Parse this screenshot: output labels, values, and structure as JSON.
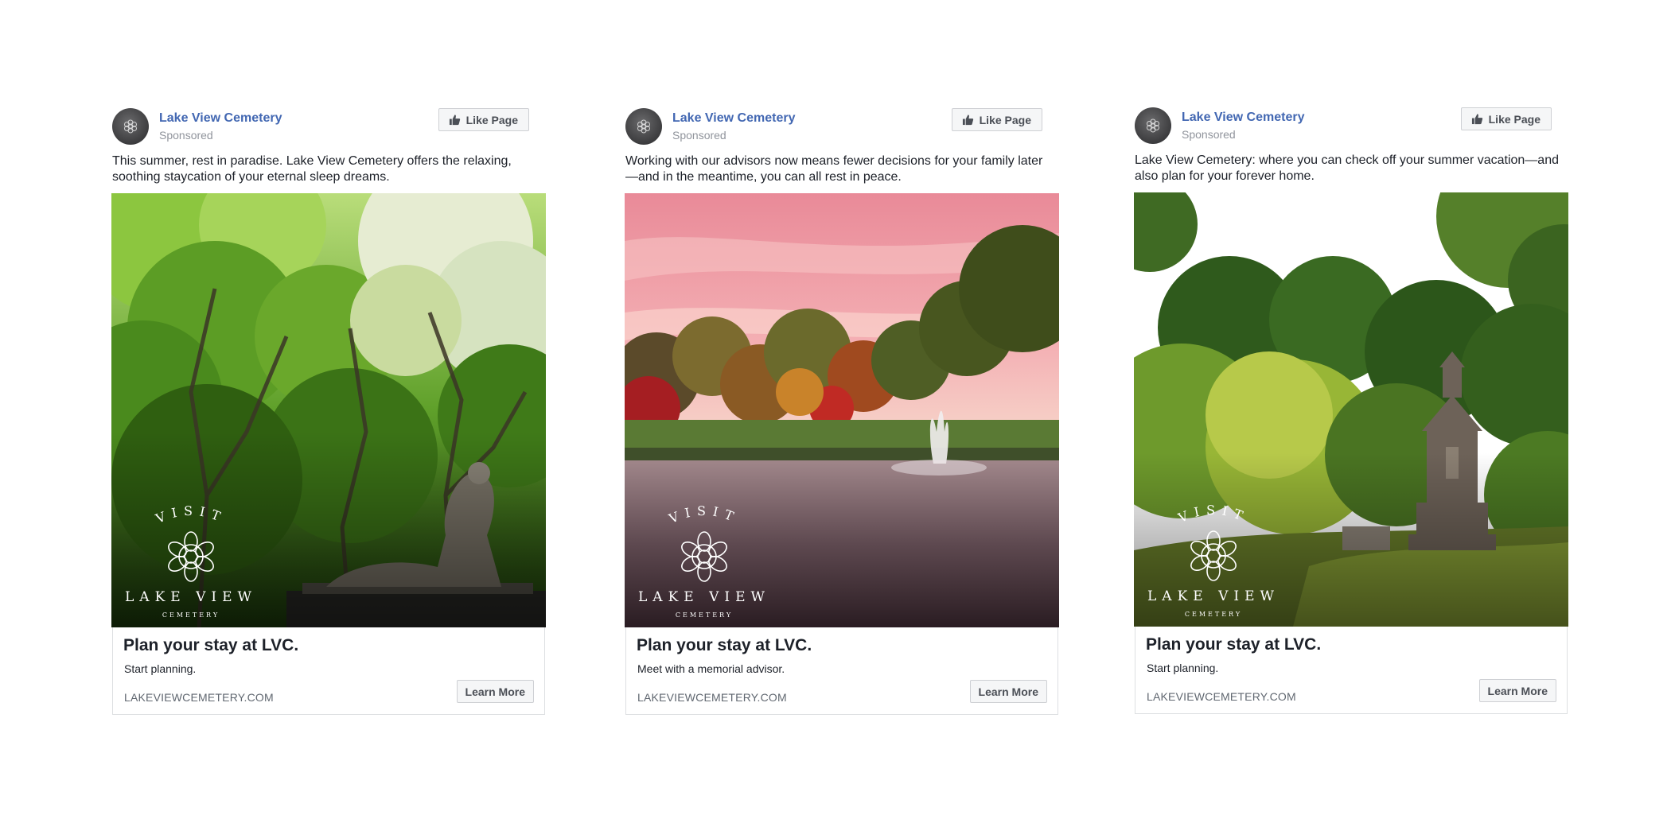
{
  "brand": {
    "page_name": "Lake View Cemetery",
    "sponsored_label": "Sponsored",
    "like_button": "Like Page",
    "link_color": "#4267b2",
    "logo_top_text": "VISIT",
    "logo_name": "LAKE VIEW",
    "logo_sub": "CEMETERY"
  },
  "ads": [
    {
      "body": "This summer, rest in paradise. Lake View Cemetery offers the relaxing, soothing staycation of your eternal sleep dreams.",
      "image": "forest-with-reclining-angel-statue",
      "headline": "Plan your stay at LVC.",
      "description": "Start planning.",
      "domain": "LAKEVIEWCEMETERY.COM",
      "cta": "Learn More"
    },
    {
      "body": "Working with our advisors now means fewer decisions for your family later—and in the meantime, you can all rest in peace.",
      "image": "pink-sunset-lake-with-fountain",
      "headline": "Plan your stay at LVC.",
      "description": "Meet with a memorial advisor.",
      "domain": "LAKEVIEWCEMETERY.COM",
      "cta": "Learn More"
    },
    {
      "body": "Lake View Cemetery: where you can check off your summer vacation—and also plan for your forever home.",
      "image": "sunlit-trees-with-stone-monument",
      "headline": "Plan your stay at LVC.",
      "description": "Start planning.",
      "domain": "LAKEVIEWCEMETERY.COM",
      "cta": "Learn More"
    }
  ]
}
